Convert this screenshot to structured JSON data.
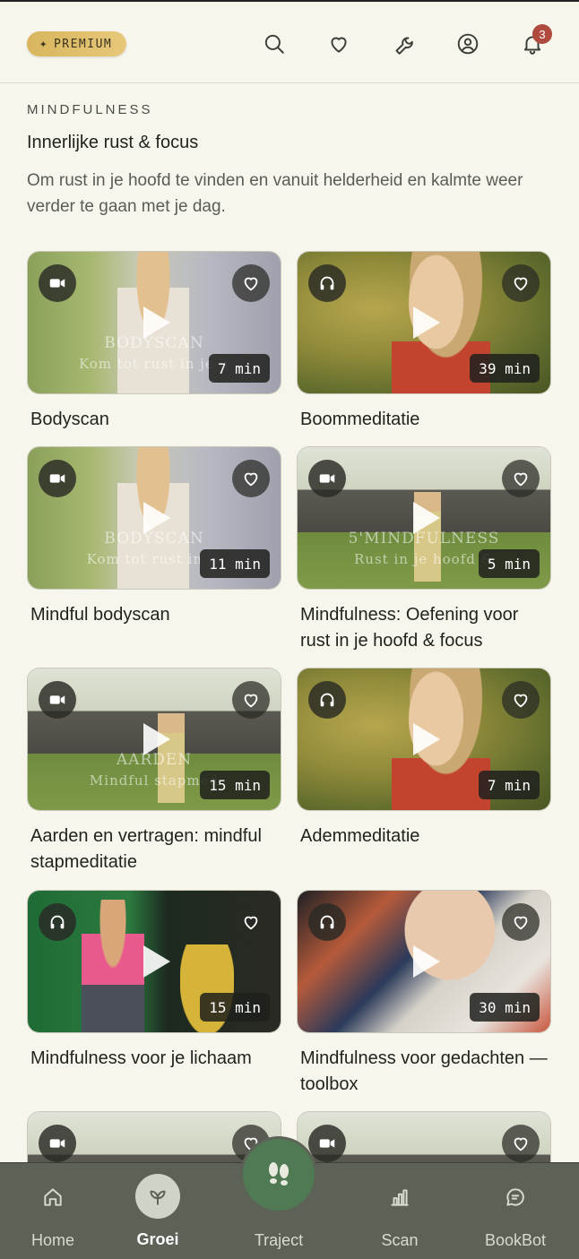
{
  "topbar": {
    "premium_label": "PREMIUM",
    "icons": [
      "search-icon",
      "heart-icon",
      "wrench-icon",
      "profile-icon",
      "bell-icon"
    ],
    "notification_count": "3"
  },
  "section": {
    "eyebrow": "MINDFULNESS",
    "title": "Innerlijke rust & focus",
    "description": "Om rust in je hoofd te vinden en vanuit helderheid en kalmte weer verder te gaan met je dag."
  },
  "cards": [
    {
      "label": "Bodyscan",
      "duration": "7 min",
      "type": "video",
      "overlay1": "BODYSCAN",
      "overlay2": "Kom tot rust in je li"
    },
    {
      "label": "Boommeditatie",
      "duration": "39 min",
      "type": "audio",
      "overlay1": "",
      "overlay2": ""
    },
    {
      "label": "Mindful bodyscan",
      "duration": "11 min",
      "type": "video",
      "overlay1": "BODYSCAN",
      "overlay2": "Kom tot rust in je"
    },
    {
      "label": "Mindfulness: Oefening voor rust in je hoofd & focus",
      "duration": "5 min",
      "type": "video",
      "overlay1": "5'MINDFULNESS",
      "overlay2": "Rust in je hoofd &"
    },
    {
      "label": "Aarden en vertragen: mindful stapmeditatie",
      "duration": "15 min",
      "type": "video",
      "overlay1": "AARDEN",
      "overlay2": "Mindful stapmed"
    },
    {
      "label": "Ademmeditatie",
      "duration": "7 min",
      "type": "audio",
      "overlay1": "",
      "overlay2": ""
    },
    {
      "label": "Mindfulness voor je lichaam",
      "duration": "15 min",
      "type": "audio",
      "overlay1": "",
      "overlay2": ""
    },
    {
      "label": "Mindfulness voor gedachten — toolbox",
      "duration": "30 min",
      "type": "audio",
      "overlay1": "",
      "overlay2": ""
    },
    {
      "label": "",
      "duration": "",
      "type": "video",
      "overlay1": "",
      "overlay2": ""
    },
    {
      "label": "",
      "duration": "",
      "type": "video",
      "overlay1": "",
      "overlay2": ""
    }
  ],
  "nav": {
    "items": [
      {
        "label": "Home",
        "icon": "home-icon"
      },
      {
        "label": "Groei",
        "icon": "leaf-icon",
        "active": true
      },
      {
        "label": "Traject",
        "icon": "footsteps-icon"
      },
      {
        "label": "Scan",
        "icon": "bar-chart-icon"
      },
      {
        "label": "BookBot",
        "icon": "chat-icon"
      }
    ]
  }
}
